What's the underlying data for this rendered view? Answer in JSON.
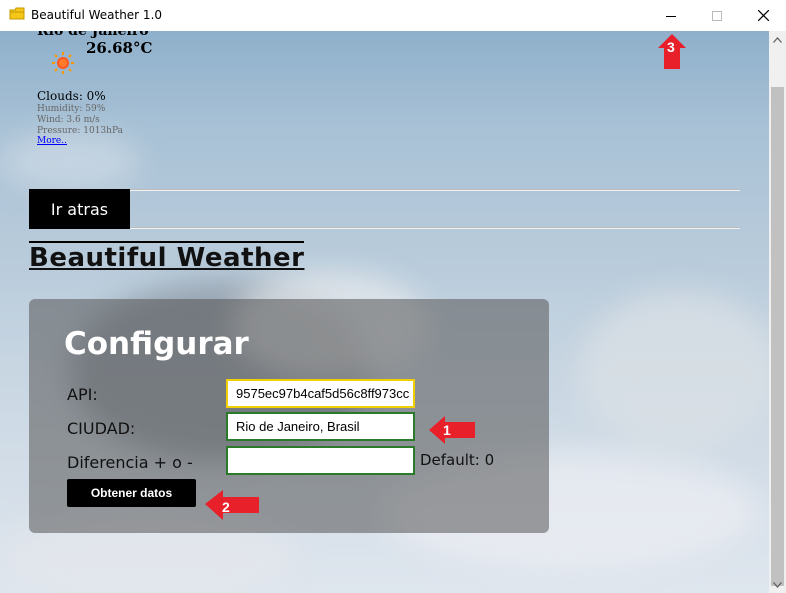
{
  "window": {
    "title": "Beautiful Weather 1.0",
    "icon": "folder-weather-icon"
  },
  "weather_widget": {
    "city": "Rio de Janeiro",
    "temperature": "26.68°C",
    "condition_icon": "sun-icon",
    "clouds": "Clouds: 0%",
    "humidity": "Humidity: 59%",
    "wind": "Wind: 3.6 m/s",
    "pressure": "Pressure: 1013hPa",
    "more_link": "More.."
  },
  "nav": {
    "back_label": "Ir atras"
  },
  "brand": {
    "title": "Beautiful Weather"
  },
  "config": {
    "title": "Configurar",
    "api_label": "API:",
    "api_value": "9575ec97b4caf5d56c8ff973cc",
    "city_label": "CIUDAD:",
    "city_value": "Rio de Janeiro, Brasil",
    "diff_label": "Diferencia + o -",
    "diff_value": "",
    "default_label": "Default: 0",
    "fetch_label": "Obtener datos"
  },
  "annotations": [
    {
      "number": "1"
    },
    {
      "number": "2"
    },
    {
      "number": "3"
    }
  ],
  "colors": {
    "accent_marker": "#e8202a",
    "api_border": "#f0d000",
    "field_border": "#2a7a2a"
  }
}
